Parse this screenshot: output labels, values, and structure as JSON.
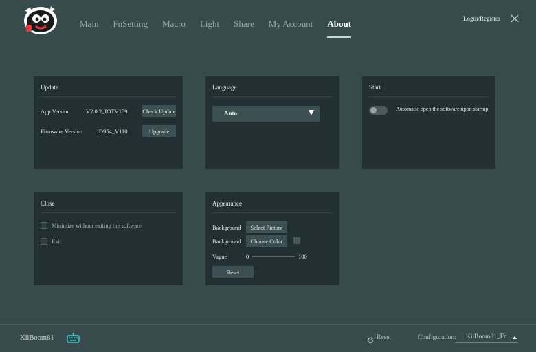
{
  "nav": {
    "items": [
      "Main",
      "FnSetting",
      "Macro",
      "Light",
      "Share",
      "My Account",
      "About"
    ],
    "active": "About"
  },
  "header": {
    "login_label": "Login/Register"
  },
  "update": {
    "title": "Update",
    "app_version_label": "App Version",
    "app_version_value": "V2.0.2_IOTV159",
    "check_update_label": "Check Update",
    "firmware_version_label": "Firmware Version",
    "firmware_version_value": "ID954_V110",
    "upgrade_label": "Upgrade"
  },
  "language": {
    "title": "Language",
    "selected": "Auto"
  },
  "start": {
    "title": "Start",
    "autostart_label": "Automatic open the software upon startup",
    "autostart_enabled": false
  },
  "close": {
    "title": "Close",
    "minimize_label": "Minimize without exiting the software",
    "minimize_checked": false,
    "exit_label": "Exit",
    "exit_checked": false
  },
  "appearance": {
    "title": "Appearance",
    "background_label_1": "Background",
    "select_picture_label": "Select Picture",
    "background_label_2": "Background",
    "choose_color_label": "Choose Color",
    "vague_label": "Vague",
    "vague_min": "0",
    "vague_max": "100",
    "vague_value": 0,
    "reset_label": "Reset"
  },
  "footer": {
    "device_name": "KiiBoom81",
    "reset_label": "Reset",
    "configuration_label": "Configuration:",
    "configuration_value": "KiiBoom81_Fn"
  },
  "colors": {
    "background": "#374a4c",
    "panel": "#223033",
    "button": "#3c4f53",
    "keyboard_icon": "#3fd0d4"
  },
  "icons": [
    "logo-mascot-icon",
    "close-icon",
    "dropdown-arrow-icon",
    "keyboard-icon",
    "reset-icon",
    "chevron-up-icon"
  ]
}
